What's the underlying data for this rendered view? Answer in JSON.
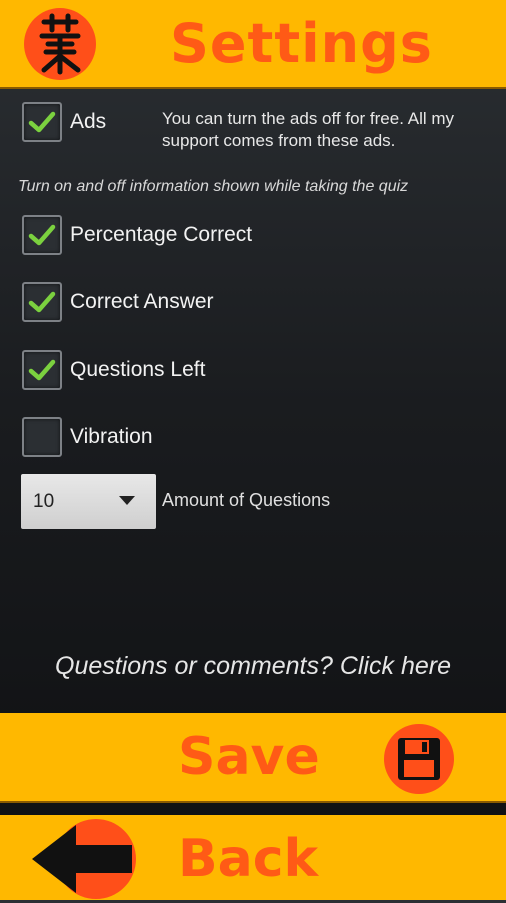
{
  "header": {
    "title": "Settings",
    "logo_icon": "kanji-logo-icon"
  },
  "settings": {
    "ads": {
      "label": "Ads",
      "checked": true,
      "description": "You can turn the ads off for free. All my support comes from these ads."
    },
    "info_text": "Turn on and off information shown while taking the quiz",
    "options": [
      {
        "label": "Percentage Correct",
        "checked": true
      },
      {
        "label": "Correct Answer",
        "checked": true
      },
      {
        "label": "Questions Left",
        "checked": true
      },
      {
        "label": "Vibration",
        "checked": false
      }
    ],
    "amount": {
      "value": "10",
      "label": "Amount of Questions"
    }
  },
  "comments_link": "Questions or comments? Click here",
  "save": {
    "label": "Save",
    "icon": "floppy-disk-icon"
  },
  "back": {
    "label": "Back",
    "icon": "arrow-left-icon"
  },
  "colors": {
    "accent": "#ffb800",
    "brand": "#ff5a16",
    "check": "#7bd13f"
  }
}
